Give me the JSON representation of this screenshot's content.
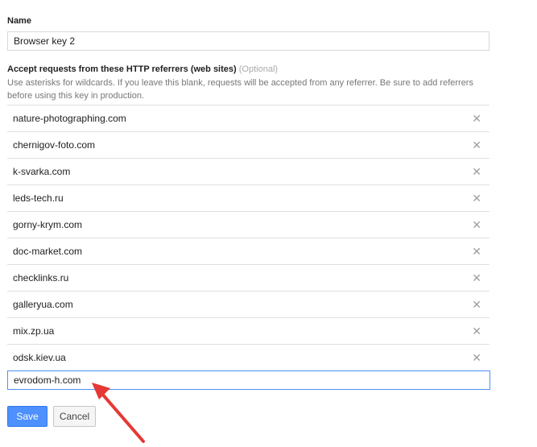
{
  "form": {
    "name_label": "Name",
    "name_value": "Browser key 2",
    "referrers_label": "Accept requests from these HTTP referrers (web sites)",
    "optional_label": "(Optional)",
    "hint": "Use asterisks for wildcards. If you leave this blank, requests will be accepted from any referrer. Be sure to add referrers before using this key in production.",
    "referrers": [
      "nature-photographing.com",
      "chernigov-foto.com",
      "k-svarka.com",
      "leds-tech.ru",
      "gorny-krym.com",
      "doc-market.com",
      "checklinks.ru",
      "galleryua.com",
      "mix.zp.ua",
      "odsk.kiev.ua"
    ],
    "new_referrer_value": "evrodom-h.com",
    "remove_icon": "close-icon",
    "save_label": "Save",
    "cancel_label": "Cancel"
  },
  "colors": {
    "accent": "#4d90fe",
    "annotation_arrow": "#e53935"
  }
}
